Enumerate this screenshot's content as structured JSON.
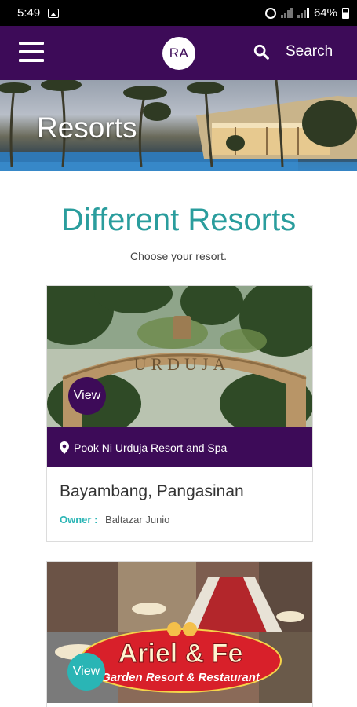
{
  "status_bar": {
    "time": "5:49",
    "battery": "64%",
    "icons": [
      "image-icon",
      "alarm-icon",
      "signal-icon",
      "signal-icon",
      "battery-icon"
    ]
  },
  "header": {
    "menu_icon": "hamburger-icon",
    "avatar_initials": "RA",
    "search_icon": "search-icon",
    "search_label": "Search"
  },
  "hero": {
    "title": "Resorts"
  },
  "section": {
    "title": "Different Resorts",
    "subtitle": "Choose your resort."
  },
  "resorts": [
    {
      "view_label": "View",
      "name": "Pook Ni Urduja Resort and Spa",
      "location": "Bayambang, Pangasinan",
      "owner_label": "Owner :",
      "owner": "Baltazar Junio",
      "sign_text": "URDUJA"
    },
    {
      "view_label": "View",
      "logo_text": "Ariel & Fe",
      "logo_subtitle": "Garden Resort & Restaurant"
    }
  ],
  "colors": {
    "primary": "#3d0b58",
    "accent": "#2ab5b5",
    "heading": "#2a9d9d"
  }
}
